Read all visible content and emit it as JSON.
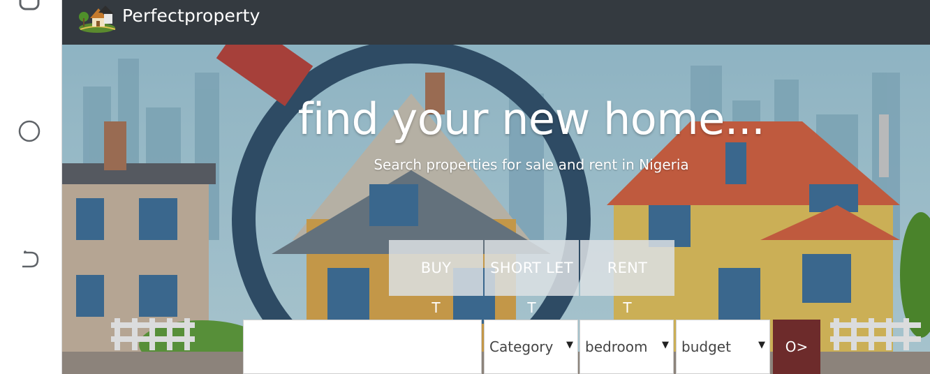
{
  "brand": {
    "name": "Perfectproperty",
    "logo_icon": "house-logo-icon"
  },
  "rail": {
    "icons": [
      "square-icon",
      "circle-icon",
      "back-icon"
    ]
  },
  "hero": {
    "headline": "find your new home...",
    "subline": "Search properties for sale and rent in Nigeria"
  },
  "tabs": [
    {
      "label": "BUY",
      "marker": "T"
    },
    {
      "label": "SHORT LET",
      "marker": "T"
    },
    {
      "label": "RENT",
      "marker": "T"
    }
  ],
  "search": {
    "input_value": "",
    "category": "Category",
    "bedroom": "bedroom",
    "budget": "budget",
    "submit_label": "O>"
  },
  "colors": {
    "topbar": "#343a40",
    "submit": "#6d2b2b",
    "tab_bg": "#dce0e4"
  }
}
